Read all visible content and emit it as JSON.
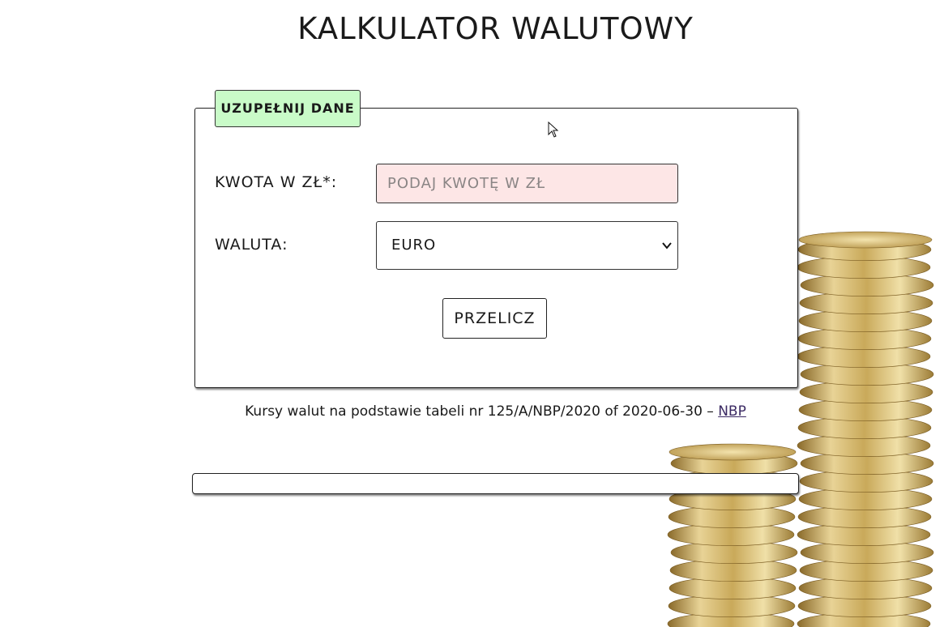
{
  "header": {
    "title": "KALKULATOR WALUTOWY"
  },
  "form": {
    "legend": "UZUPEŁNIJ DANE",
    "amount_label": "KWOTA W ZŁ*:",
    "amount_value": "",
    "amount_placeholder": "PODAJ KWOTĘ W ZŁ",
    "currency_label": "WALUTA:",
    "currency_selected": "EURO",
    "submit_label": "PRZELICZ"
  },
  "footer": {
    "rates_text": "Kursy walut na podstawie tabeli nr 125/A/NBP/2020 of 2020-06-30 – ",
    "rates_link": "NBP"
  },
  "result": {
    "text": ""
  },
  "colors": {
    "legend_bg": "#c9fbc8",
    "input_bg": "#fde6e6",
    "coin_gold": "#d9bf74"
  },
  "icons": {
    "select_arrow": "chevron-down-icon",
    "pointer": "mouse-cursor-icon"
  }
}
